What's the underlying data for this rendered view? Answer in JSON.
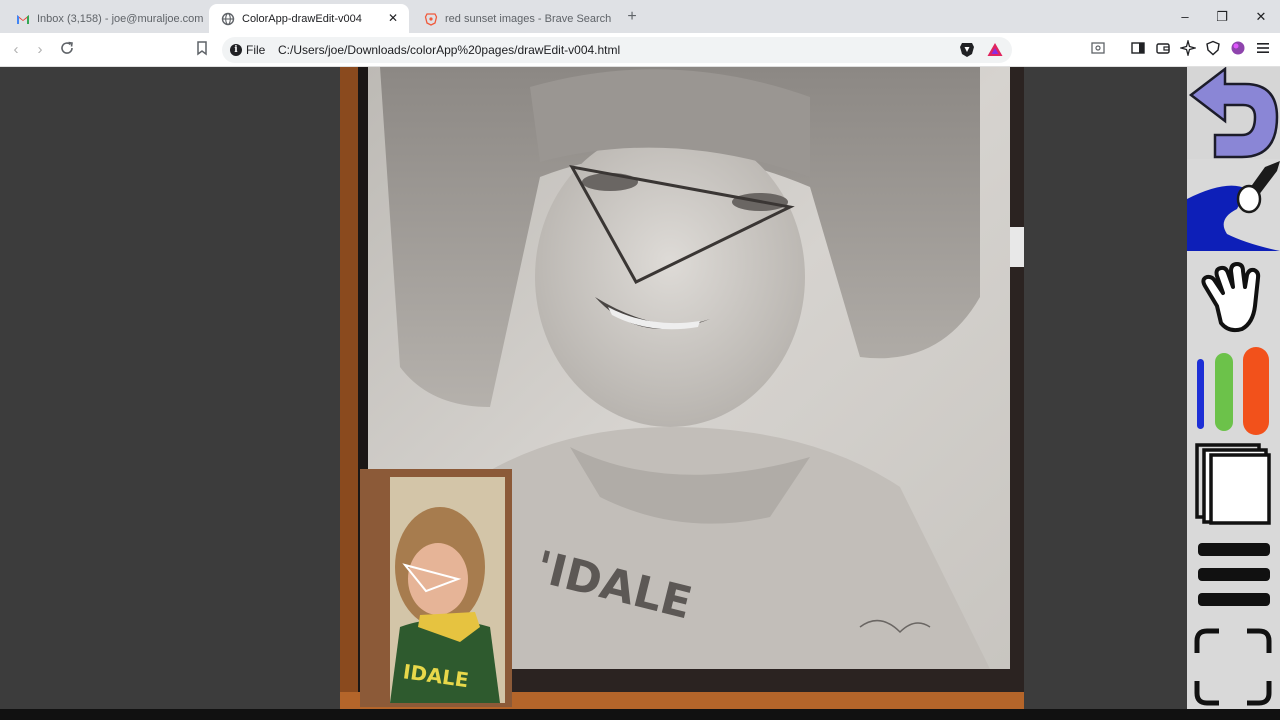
{
  "browser": {
    "tabs": [
      {
        "label": "Inbox (3,158) - joe@muraljoe.com - ",
        "icon": "gmail-icon",
        "active": false
      },
      {
        "label": "ColorApp-drawEdit-v004",
        "icon": "globe-icon",
        "active": true
      },
      {
        "label": "red sunset images - Brave Search",
        "icon": "brave-icon",
        "active": false
      }
    ],
    "new_tab": "+",
    "window_controls": {
      "minimize": "–",
      "maximize": "❐",
      "close": "✕"
    },
    "address": {
      "scheme": "File",
      "url": "C:/Users/joe/Downloads/colorApp%20pages/drawEdit-v004.html"
    }
  },
  "canvas": {
    "sweatshirt_text": "'IDALE",
    "small_photo_text": "IDALE",
    "image_description_icon": "pencil-portrait-photo"
  },
  "sidebar": {
    "tools": [
      "undo-icon",
      "paint-brush-icon",
      "hand-pan-icon",
      "color-markers-icon",
      "layers-icon",
      "menu-icon",
      "fullscreen-icon"
    ]
  },
  "colors": {
    "tool_purple": "#8a86d6",
    "brush_blue": "#0d1fb8",
    "marker_blue": "#1d2fd6",
    "marker_green": "#6cc24a",
    "marker_orange": "#f2511b",
    "frame_wood": "#a0521c"
  }
}
